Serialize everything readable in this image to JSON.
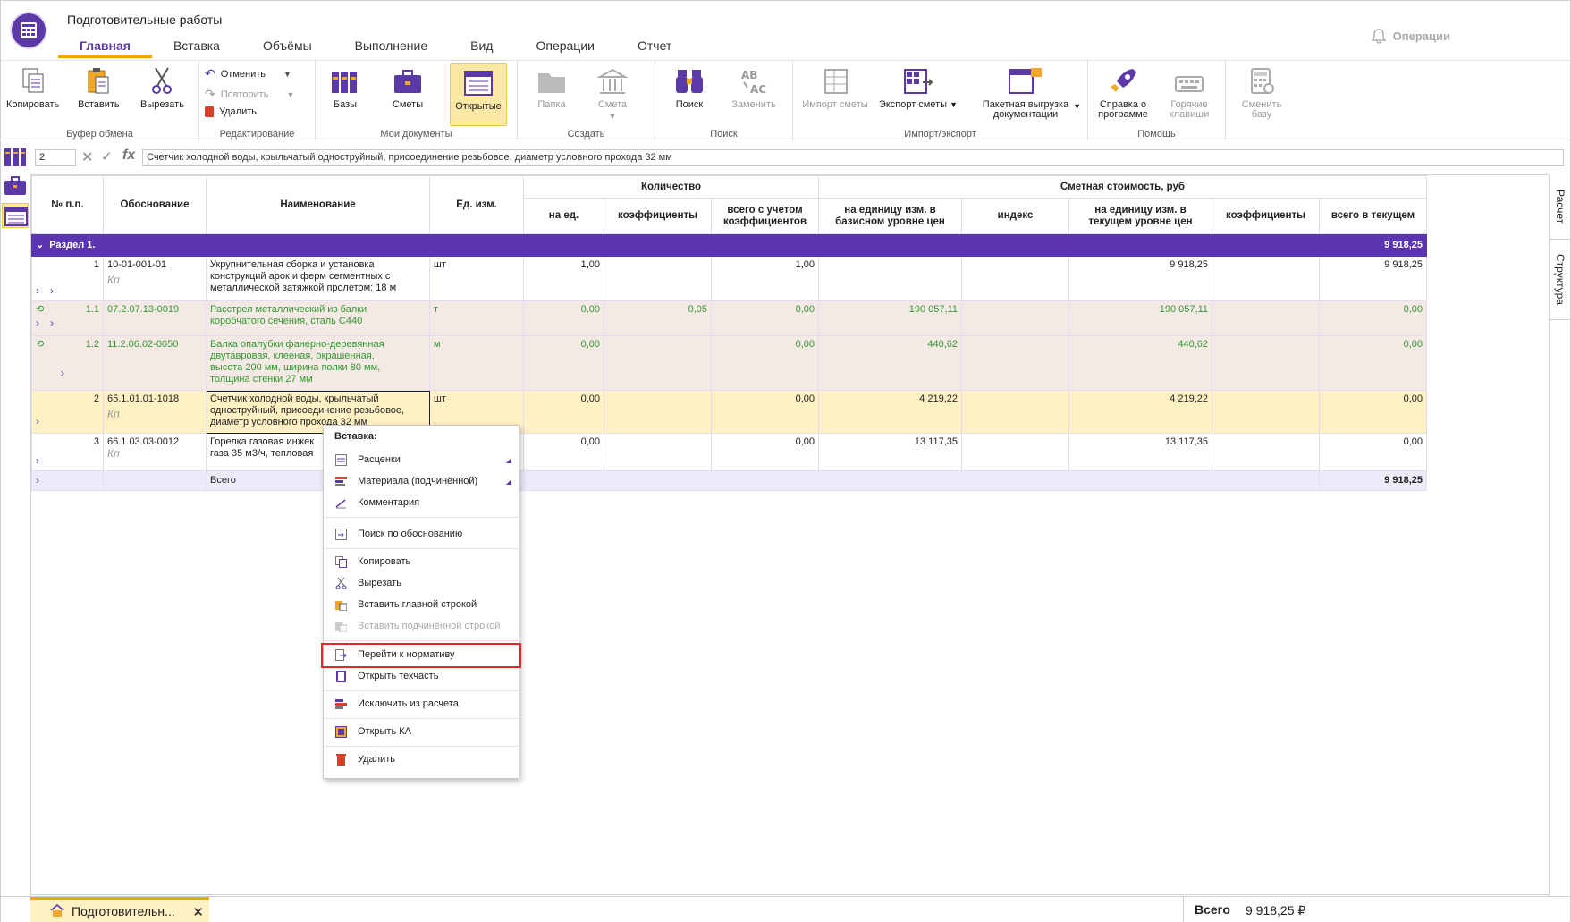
{
  "window": {
    "title": "Подготовительные работы"
  },
  "tabs": [
    "Главная",
    "Вставка",
    "Объёмы",
    "Выполнение",
    "Вид",
    "Операции",
    "Отчет"
  ],
  "active_tab": "Главная",
  "operations_label": "Операции",
  "ribbon": {
    "clipboard": {
      "title": "Буфер обмена",
      "copy": "Копировать",
      "paste": "Вставить",
      "cut": "Вырезать"
    },
    "editing": {
      "title": "Редактирование",
      "undo": "Отменить",
      "redo": "Повторить",
      "delete": "Удалить"
    },
    "mydocs": {
      "title": "Мои документы",
      "bases": "Базы",
      "estimates": "Сметы",
      "open": "Открытые"
    },
    "create": {
      "title": "Создать",
      "folder": "Папка",
      "estimate": "Смета"
    },
    "search": {
      "title": "Поиск",
      "find": "Поиск",
      "replace": "Заменить"
    },
    "impexp": {
      "title": "Импорт/экспорт",
      "import": "Импорт сметы",
      "export": "Экспорт сметы",
      "batch1": "Пакетная выгрузка",
      "batch2": "документации"
    },
    "help": {
      "title": "Помощь",
      "about1": "Справка о",
      "about2": "программе",
      "hotkeys1": "Горячие",
      "hotkeys2": "клавиши"
    },
    "changebase": {
      "label1": "Сменить",
      "label2": "базу"
    }
  },
  "formula": {
    "cell_ref": "2",
    "text": "Счетчик холодной воды, крыльчатый одноструйный, присоединение резьбовое, диаметр условного прохода 32 мм"
  },
  "side_tabs": [
    "Расчет",
    "Структура"
  ],
  "grid": {
    "headers": {
      "num": "№ п.п.",
      "basis": "Обоснование",
      "name": "Наименование",
      "unit": "Ед. изм.",
      "qty_group": "Количество",
      "qty_per": "на ед.",
      "qty_coef": "коэффициенты",
      "qty_total1": "всего с учетом",
      "qty_total2": "коэффициентов",
      "cost_group": "Сметная стоимость, руб",
      "base1": "на единицу изм. в",
      "base2": "базисном уровне цен",
      "index": "индекс",
      "cur1": "на единицу изм. в",
      "cur2": "текущем уровне цен",
      "cost_coef": "коэффициенты",
      "cur_total": "всего в текущем"
    },
    "section": {
      "label": "Раздел 1.",
      "total": "9 918,25"
    },
    "kp": "Кп",
    "rows": [
      {
        "num": "1",
        "code": "10-01-001-01",
        "name": [
          "Укрупнительная сборка и установка",
          "конструкций арок и ферм сегментных с",
          "металлической затяжкой пролетом: 18 м"
        ],
        "unit": "шт",
        "qty": "1,00",
        "qcoef": "",
        "qtotal": "1,00",
        "base": "",
        "index": "",
        "cur": "9 918,25",
        "ccoef": "",
        "total": "9 918,25"
      },
      {
        "num": "1.1",
        "code": "07.2.07.13-0019",
        "name": [
          "Расстрел металлический из балки",
          "коробчатого сечения, сталь С440"
        ],
        "unit": "т",
        "qty": "0,00",
        "qcoef": "0,05",
        "qtotal": "0,00",
        "base": "190 057,11",
        "index": "",
        "cur": "190 057,11",
        "ccoef": "",
        "total": "0,00"
      },
      {
        "num": "1.2",
        "code": "11.2.06.02-0050",
        "name": [
          "Балка опалубки фанерно-деревянная",
          "двутавровая, клееная, окрашенная,",
          "высота 200 мм, ширина полки 80 мм,",
          "толщина стенки 27 мм"
        ],
        "unit": "м",
        "qty": "0,00",
        "qcoef": "",
        "qtotal": "0,00",
        "base": "440,62",
        "index": "",
        "cur": "440,62",
        "ccoef": "",
        "total": "0,00"
      },
      {
        "num": "2",
        "code": "65.1.01.01-1018",
        "name": [
          "Счетчик холодной воды, крыльчатый",
          "одноструйный, присоединение резьбовое,",
          "диаметр условного прохода 32 мм"
        ],
        "unit": "шт",
        "qty": "0,00",
        "qcoef": "",
        "qtotal": "0,00",
        "base": "4 219,22",
        "index": "",
        "cur": "4 219,22",
        "ccoef": "",
        "total": "0,00"
      },
      {
        "num": "3",
        "code": "66.1.03.03-0012",
        "name": [
          "Горелка газовая инжек",
          "газа 35 м3/ч, тепловая"
        ],
        "unit": "",
        "qty": "0,00",
        "qcoef": "",
        "qtotal": "0,00",
        "base": "13 117,35",
        "index": "",
        "cur": "13 117,35",
        "ccoef": "",
        "total": "0,00"
      }
    ],
    "total_row": {
      "label": "Всего",
      "total": "9 918,25"
    }
  },
  "context_menu": {
    "header": "Вставка:",
    "items": [
      "Расценки",
      "Материала (подчинённой)",
      "Комментария",
      "Поиск по обоснованию",
      "Копировать",
      "Вырезать",
      "Вставить главной строкой",
      "Вставить подчинённой строкой",
      "Перейти к нормативу",
      "Открыть техчасть",
      "Исключить из расчета",
      "Открыть КА",
      "Удалить"
    ]
  },
  "bottom": {
    "doc_tab": "Подготовительн...",
    "total_label": "Всего",
    "total_value": "9 918,25 ₽"
  },
  "colors": {
    "accent": "#5b3aa8",
    "tab_underline": "#f7a600",
    "section_bg": "#5b35b1",
    "material_text": "#2f9a2f",
    "highlight": "#e32727"
  }
}
